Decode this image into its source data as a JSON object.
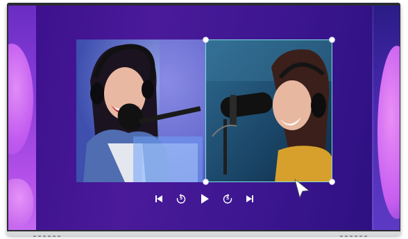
{
  "player": {
    "controls": [
      {
        "name": "previous-button",
        "icon": "skip-previous-icon"
      },
      {
        "name": "rewind-button",
        "icon": "rewind-5-icon",
        "label": "5"
      },
      {
        "name": "play-button",
        "icon": "play-icon"
      },
      {
        "name": "forward-button",
        "icon": "forward-5-icon",
        "label": "5"
      },
      {
        "name": "next-button",
        "icon": "skip-next-icon"
      }
    ]
  },
  "colors": {
    "background": "#3a0f8a",
    "selection_border": "#7fe0e0",
    "accent_pink": "#e18df7"
  }
}
